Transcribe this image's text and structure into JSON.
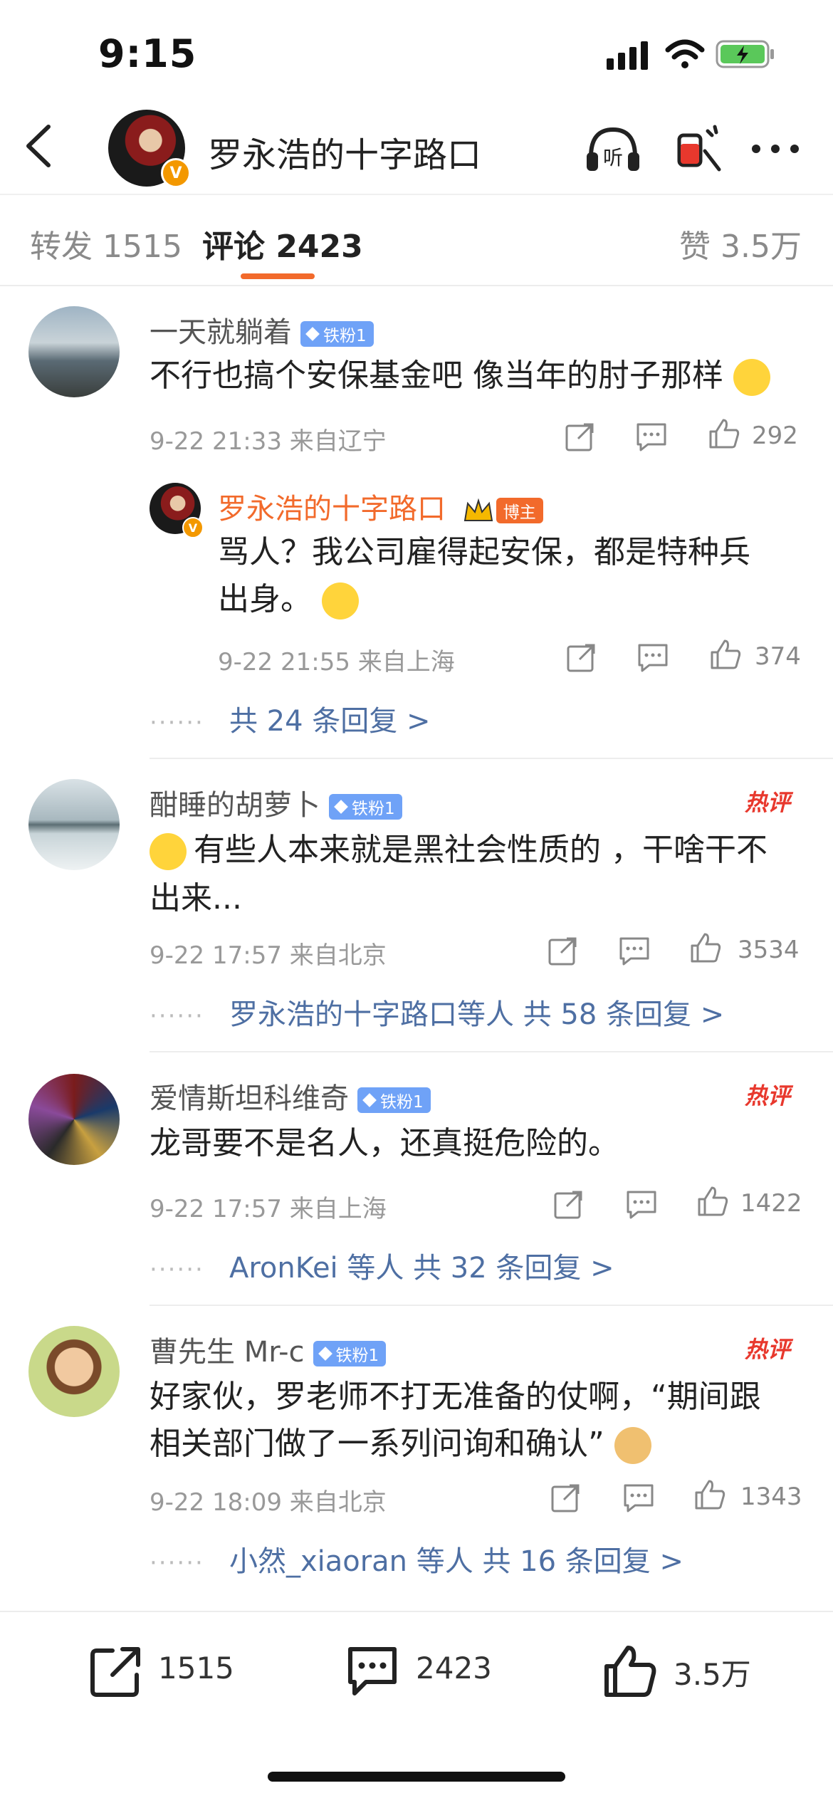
{
  "status_bar": {
    "time": "9:15"
  },
  "nav": {
    "title": "罗永浩的十字路口"
  },
  "tabs": {
    "repost": "转发 1515",
    "comments": "评论 2423",
    "likes": "赞 3.5万"
  },
  "comments": [
    {
      "user": "一天就躺着",
      "badge": "铁粉1",
      "text": "不行也搞个安保基金吧 像当年的肘子那样",
      "meta": "9-22 21:33 来自辽宁",
      "likes": "292",
      "reply": {
        "user": "罗永浩的十字路口",
        "badge": "博主",
        "text_line1": "骂人？我公司雇得起安保，都是特种兵",
        "text_line2": "出身。",
        "meta": "9-22 21:55 来自上海",
        "likes": "374"
      },
      "replies_link": "共 24 条回复 >"
    },
    {
      "user": "酣睡的胡萝卜",
      "badge": "铁粉1",
      "hot": "热评",
      "text_line1": "有些人本来就是黑社会性质的 ，干啥干不",
      "text_line2": "出来...",
      "meta": "9-22 17:57 来自北京",
      "likes": "3534",
      "replies_link": "罗永浩的十字路口等人  共 58 条回复 >"
    },
    {
      "user": "爱情斯坦科维奇",
      "badge": "铁粉1",
      "hot": "热评",
      "text": "龙哥要不是名人，还真挺危险的。",
      "meta": "9-22 17:57 来自上海",
      "likes": "1422",
      "replies_link": "AronKei 等人  共 32 条回复 >"
    },
    {
      "user": "曹先生 Mr-c",
      "badge": "铁粉1",
      "hot": "热评",
      "text_line1": "好家伙，罗老师不打无准备的仗啊，“期间跟",
      "text_line2": "相关部门做了一系列问询和确认”",
      "meta": "9-22 18:09 来自北京",
      "likes": "1343",
      "replies_link": "小然_xiaoran 等人  共 16 条回复 >"
    }
  ],
  "bottom_bar": {
    "reposts": "1515",
    "comments": "2423",
    "likes": "3.5万"
  },
  "colors": {
    "accent": "#f26a2b",
    "link": "#4e6fa3",
    "fan_badge": "#6fa2f7",
    "hot": "#e8382d",
    "blogger": "#f26a2b"
  }
}
